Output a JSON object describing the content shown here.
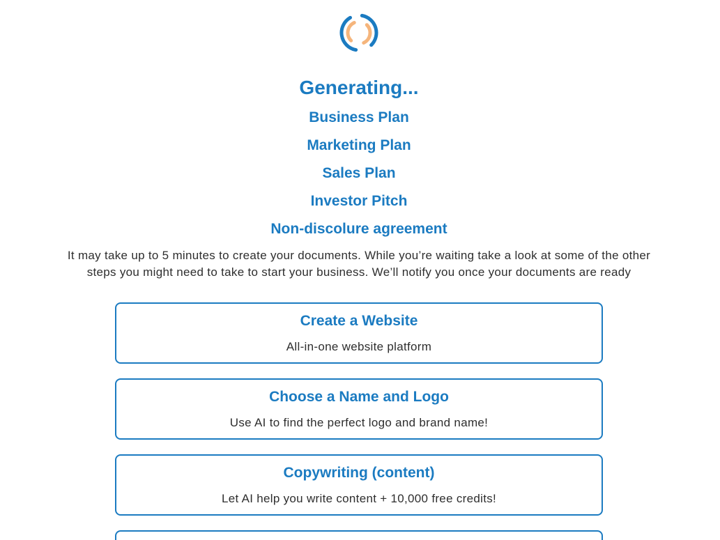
{
  "colors": {
    "accent": "#1b7bc1",
    "text": "#2e2e2e",
    "spinner_outer": "#1b7bc1",
    "spinner_inner": "#f5b57c",
    "background": "#ffffff"
  },
  "spinner": {
    "icon": "loading-spinner-icon"
  },
  "status": {
    "title": "Generating..."
  },
  "documents": [
    {
      "label": "Business Plan"
    },
    {
      "label": "Marketing Plan"
    },
    {
      "label": "Sales Plan"
    },
    {
      "label": "Investor Pitch"
    },
    {
      "label": "Non-discolure agreement"
    }
  ],
  "message": "It may take up to 5 minutes to create your documents. While you’re waiting take a look at some of the other steps you might need to take to start your business. We’ll notify you once your documents are ready",
  "cards": [
    {
      "title": "Create a Website",
      "description": "All-in-one website platform"
    },
    {
      "title": "Choose a Name and Logo",
      "description": "Use AI to find the perfect logo and brand name!"
    },
    {
      "title": "Copywriting (content)",
      "description": "Let AI help you write content + 10,000 free credits!"
    }
  ]
}
